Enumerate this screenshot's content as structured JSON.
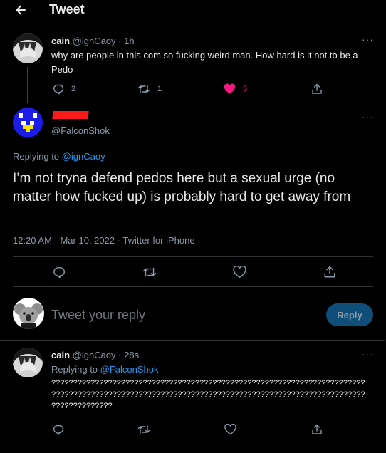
{
  "header": {
    "title": "Tweet"
  },
  "parent_tweet": {
    "name": "cain",
    "handle": "@ignCaoy",
    "time": "· 1h",
    "text": "why are people in this com so fucking weird man. How hard is it not to be a Pedo",
    "replies": "2",
    "retweets": "1",
    "likes": "5",
    "like_color": "#f91880"
  },
  "main_tweet": {
    "handle": "@FalconShok",
    "replying_label": "Replying to",
    "replying_to": "@ignCaoy",
    "text": "I’m not tryna defend pedos here but a sexual urge (no matter how fucked up) is probably hard to get away from",
    "timestamp": "12:20 AM · Mar 10, 2022 · Twitter for iPhone"
  },
  "composer": {
    "placeholder": "Tweet your reply",
    "reply_button": "Reply"
  },
  "reply_tweet": {
    "name": "cain",
    "handle": "@ignCaoy",
    "time": "· 28s",
    "replying_label": "Replying to",
    "replying_to": "@FalconShok",
    "text_line1": "????????????????????????????????????????????????????????????????????????",
    "text_line2": "????????????????????????????????????????????????????????????????????????",
    "text_line3": "??????????????"
  },
  "colors": {
    "accent": "#1d9bf0",
    "background": "#000000",
    "redaction": "#ff1a1a"
  }
}
